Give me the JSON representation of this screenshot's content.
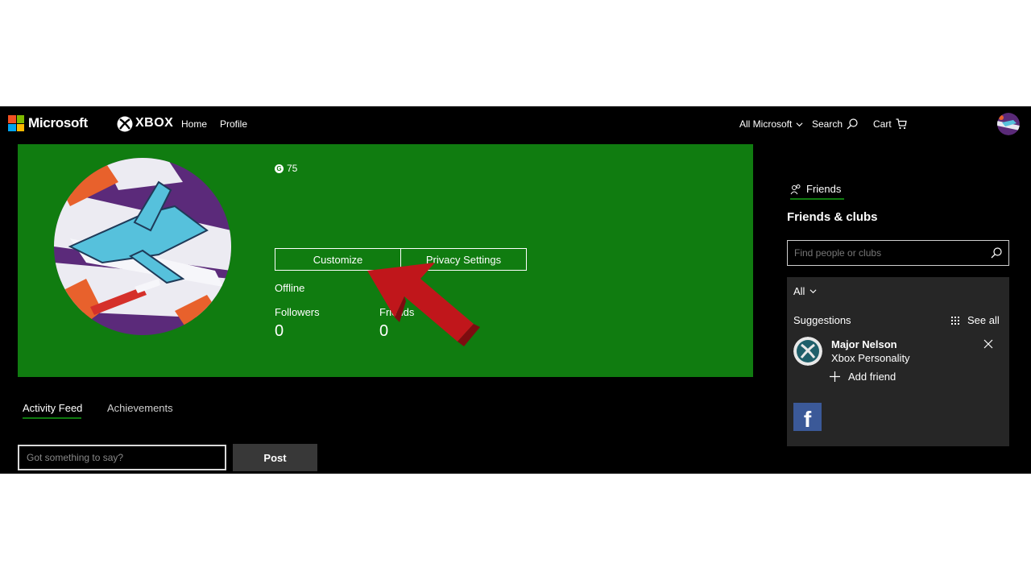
{
  "colors": {
    "xbox_green": "#107c10",
    "nav_bg": "#000000",
    "panel_bg": "#262626",
    "facebook_blue": "#3b5998",
    "arrow_red": "#c0161b"
  },
  "header": {
    "brand": "Microsoft",
    "product": "XBOX",
    "links": [
      "Home",
      "Profile"
    ],
    "all_microsoft": "All Microsoft",
    "search": "Search",
    "cart": "Cart"
  },
  "profile": {
    "gamerscore": "75",
    "customize_label": "Customize",
    "privacy_label": "Privacy Settings",
    "status": "Offline",
    "followers_label": "Followers",
    "followers_value": "0",
    "friends_label": "Friends",
    "friends_value": "0"
  },
  "tabs": {
    "activity": "Activity Feed",
    "achievements": "Achievements"
  },
  "post": {
    "placeholder": "Got something to say?",
    "button": "Post"
  },
  "sidebar": {
    "friends_tab": "Friends",
    "title": "Friends & clubs",
    "search_placeholder": "Find people or clubs",
    "filter": "All",
    "suggestions_label": "Suggestions",
    "see_all": "See all",
    "suggestion": {
      "name": "Major Nelson",
      "subtitle": "Xbox Personality",
      "action": "Add friend"
    },
    "facebook_icon": "facebook-icon"
  },
  "icons": [
    "microsoft-logo-icon",
    "xbox-logo-icon",
    "chevron-down-icon",
    "search-icon",
    "cart-icon",
    "friends-icon",
    "grid-icon",
    "close-icon",
    "plus-icon",
    "gamerscore-icon",
    "red-arrow-icon"
  ]
}
